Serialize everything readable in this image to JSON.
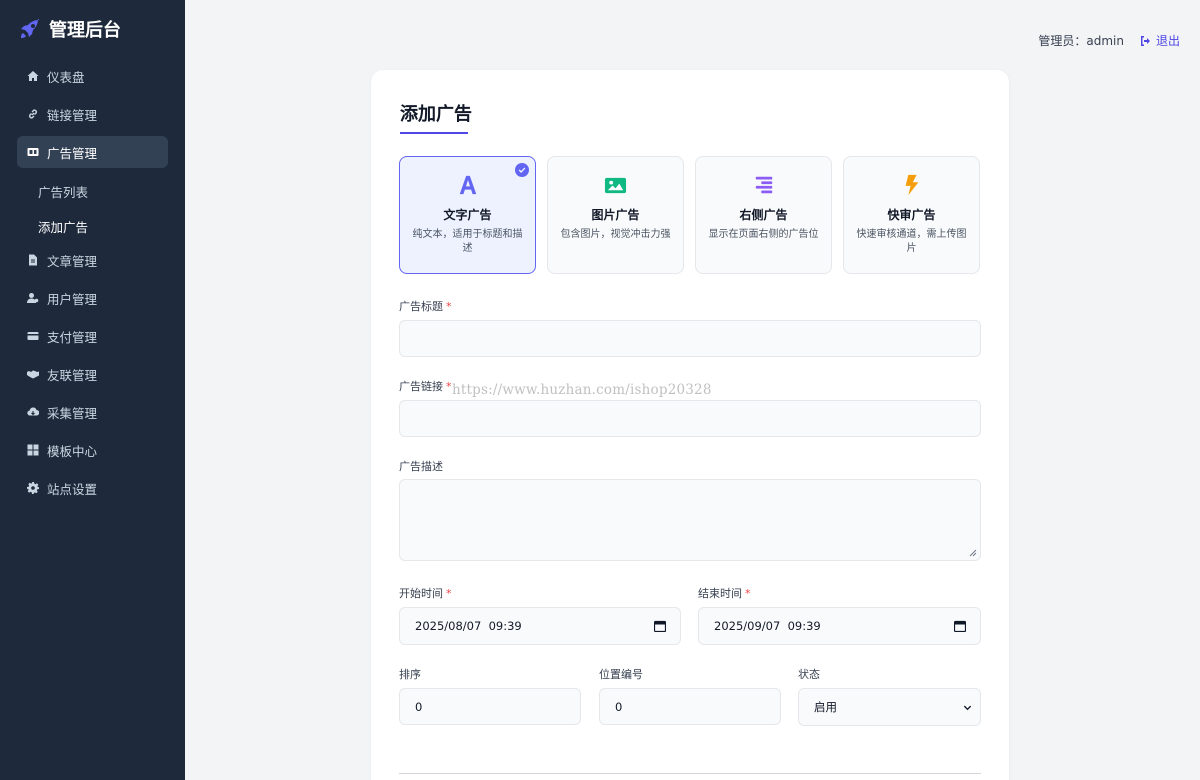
{
  "brand": {
    "title": "管理后台",
    "icon": "rocket-icon",
    "accent": "#6366f1"
  },
  "sidebar": {
    "items": [
      {
        "label": "仪表盘",
        "icon": "home-icon"
      },
      {
        "label": "链接管理",
        "icon": "link-icon"
      },
      {
        "label": "广告管理",
        "icon": "ad-icon",
        "active": true
      },
      {
        "label": "文章管理",
        "icon": "file-icon"
      },
      {
        "label": "用户管理",
        "icon": "user-cog-icon"
      },
      {
        "label": "支付管理",
        "icon": "credit-card-icon"
      },
      {
        "label": "友联管理",
        "icon": "handshake-icon"
      },
      {
        "label": "采集管理",
        "icon": "cloud-download-icon"
      },
      {
        "label": "模板中心",
        "icon": "grid-icon"
      },
      {
        "label": "站点设置",
        "icon": "gear-icon"
      }
    ],
    "subitems": [
      {
        "label": "广告列表"
      },
      {
        "label": "添加广告",
        "current": true
      }
    ]
  },
  "header": {
    "admin_label": "管理员：admin",
    "logout_label": "退出",
    "logout_icon": "sign-out-icon"
  },
  "form": {
    "title": "添加广告",
    "ad_types": [
      {
        "name": "文字广告",
        "desc": "纯文本，适用于标题和描述",
        "icon": "font-icon",
        "color": "#6366f1",
        "selected": true
      },
      {
        "name": "图片广告",
        "desc": "包含图片，视觉冲击力强",
        "icon": "image-icon",
        "color": "#10b981",
        "selected": false
      },
      {
        "name": "右侧广告",
        "desc": "显示在页面右侧的广告位",
        "icon": "align-right-icon",
        "color": "#8b5cf6",
        "selected": false
      },
      {
        "name": "快审广告",
        "desc": "快速审核通道，需上传图片",
        "icon": "bolt-icon",
        "color": "#f59e0b",
        "selected": false
      }
    ],
    "ad_title_label": "广告标题",
    "ad_title_value": "",
    "ad_link_label": "广告链接",
    "ad_link_value": "",
    "ad_desc_label": "广告描述",
    "ad_desc_value": "",
    "start_label": "开始时间",
    "start_value": "2025/08/07  09:39",
    "end_label": "结束时间",
    "end_value": "2025/09/07  09:39",
    "sort_label": "排序",
    "sort_value": "0",
    "position_label": "位置编号",
    "position_value": "0",
    "status_label": "状态",
    "status_value": "启用",
    "required_mark": "*"
  },
  "watermark": "https://www.huzhan.com/ishop20328"
}
